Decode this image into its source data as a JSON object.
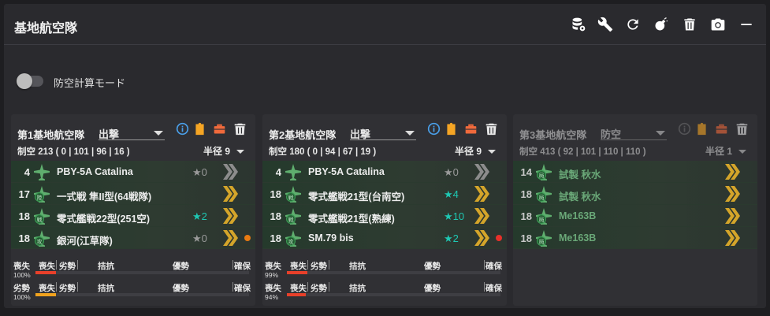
{
  "header": {
    "title": "基地航空隊"
  },
  "toolbar_icons": [
    "database-cog-icon",
    "wrench-icon",
    "refresh-icon",
    "bomb-icon",
    "trash-icon",
    "camera-icon",
    "minimize-icon"
  ],
  "air_defense_mode": {
    "label": "防空計算モード",
    "enabled": false
  },
  "colors": {
    "blue": "#4a9fe8",
    "orange": "#f5a524",
    "red_orange": "#f06a3c",
    "teal": "#1ec7b2",
    "bar_red": "#e8402a",
    "bar_orange": "#f0a21e",
    "chevron_gold": "#d4a52a"
  },
  "bar_labels": {
    "loss": "喪失",
    "inferior": "劣勢",
    "parity": "拮抗",
    "superiority": "優勢",
    "supremacy": "確保"
  },
  "corps": [
    {
      "name": "第1基地航空隊",
      "mode": "出撃",
      "air_power": "制空 213 ( 0 | 101 | 96 | 16 )",
      "radius": "半径 9",
      "planes": [
        {
          "count": "4",
          "name": "PBY-5A Catalina",
          "star": "★0",
          "star_color": "#9a9a9a",
          "icon": "patrol-plane-icon",
          "prof_color": "#8c8c8c",
          "dot": ""
        },
        {
          "count": "17",
          "name": "一式戦 隼II型(64戦隊)",
          "star": "",
          "star_color": "#1ec7b2",
          "icon": "land-fighter-icon",
          "prof_color": "#d4a52a",
          "dot": ""
        },
        {
          "count": "18",
          "name": "零式艦戦22型(251空)",
          "star": "★2",
          "star_color": "#1ec7b2",
          "icon": "fighter-icon",
          "prof_color": "#d4a52a",
          "dot": ""
        },
        {
          "count": "18",
          "name": "銀河(江草隊)",
          "star": "★0",
          "star_color": "#9a9a9a",
          "icon": "land-bomber-icon",
          "prof_color": "#d4a52a",
          "dot": "#e87a12"
        }
      ],
      "wave1": {
        "left": "喪失",
        "pct": "100%",
        "value": 1.0,
        "color": "#e8402a"
      },
      "wave2": {
        "left": "劣勢",
        "pct": "100%",
        "value": 1.0,
        "color": "#f0a21e"
      }
    },
    {
      "name": "第2基地航空隊",
      "mode": "出撃",
      "air_power": "制空 180 ( 0 | 94 | 67 | 19 )",
      "radius": "半径 9",
      "planes": [
        {
          "count": "4",
          "name": "PBY-5A Catalina",
          "star": "★0",
          "star_color": "#9a9a9a",
          "icon": "patrol-plane-icon",
          "prof_color": "#8c8c8c",
          "dot": ""
        },
        {
          "count": "18",
          "name": "零式艦戦21型(台南空)",
          "star": "★4",
          "star_color": "#1ec7b2",
          "icon": "fighter-icon",
          "prof_color": "#d4a52a",
          "dot": ""
        },
        {
          "count": "18",
          "name": "零式艦戦21型(熟練)",
          "star": "★10",
          "star_color": "#1ec7b2",
          "icon": "fighter-icon",
          "prof_color": "#d4a52a",
          "dot": ""
        },
        {
          "count": "18",
          "name": "SM.79 bis",
          "star": "★2",
          "star_color": "#1ec7b2",
          "icon": "land-bomber-icon",
          "prof_color": "#d4a52a",
          "dot": "#e8302a"
        }
      ],
      "wave1": {
        "left": "喪失",
        "pct": "99%",
        "value": 0.99,
        "color": "#e8402a"
      },
      "wave2": {
        "left": "喪失",
        "pct": "94%",
        "value": 0.94,
        "color": "#e8402a"
      }
    },
    {
      "name": "第3基地航空隊",
      "mode": "防空",
      "air_power": "制空 413 ( 92 | 101 | 110 | 110 )",
      "radius": "半径 1",
      "planes": [
        {
          "count": "14",
          "name": "試製 秋水",
          "star": "",
          "star_color": "#1ec7b2",
          "icon": "interceptor-icon",
          "prof_color": "#d4a52a",
          "dot": ""
        },
        {
          "count": "18",
          "name": "試製 秋水",
          "star": "",
          "star_color": "#1ec7b2",
          "icon": "interceptor-icon",
          "prof_color": "#d4a52a",
          "dot": ""
        },
        {
          "count": "18",
          "name": "Me163B",
          "star": "",
          "star_color": "#1ec7b2",
          "icon": "interceptor-icon",
          "prof_color": "#d4a52a",
          "dot": ""
        },
        {
          "count": "18",
          "name": "Me163B",
          "star": "",
          "star_color": "#1ec7b2",
          "icon": "interceptor-icon",
          "prof_color": "#d4a52a",
          "dot": ""
        }
      ]
    }
  ]
}
